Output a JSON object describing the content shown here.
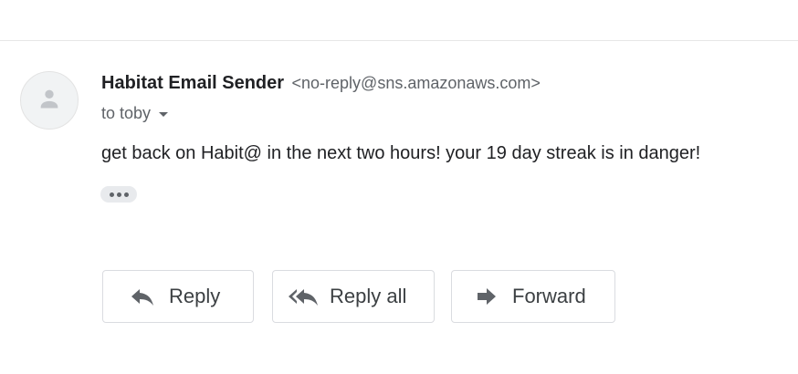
{
  "email": {
    "sender_name": "Habitat Email Sender",
    "sender_email": "<no-reply@sns.amazonaws.com>",
    "to_line": "to toby",
    "body": "get back on Habit@ in the next two hours! your 19 day streak is in danger!"
  },
  "actions": {
    "reply_label": "Reply",
    "reply_all_label": "Reply all",
    "forward_label": "Forward"
  },
  "icons": {
    "avatar": "person-icon",
    "to_expand": "caret-down-icon",
    "ellipsis": "more-horiz-icon",
    "reply": "reply-icon",
    "reply_all": "reply-all-icon",
    "forward": "forward-icon"
  },
  "colors": {
    "icon_gray": "#5f6368",
    "avatar_glyph": "#c2c5c9",
    "border": "#dadce0"
  }
}
